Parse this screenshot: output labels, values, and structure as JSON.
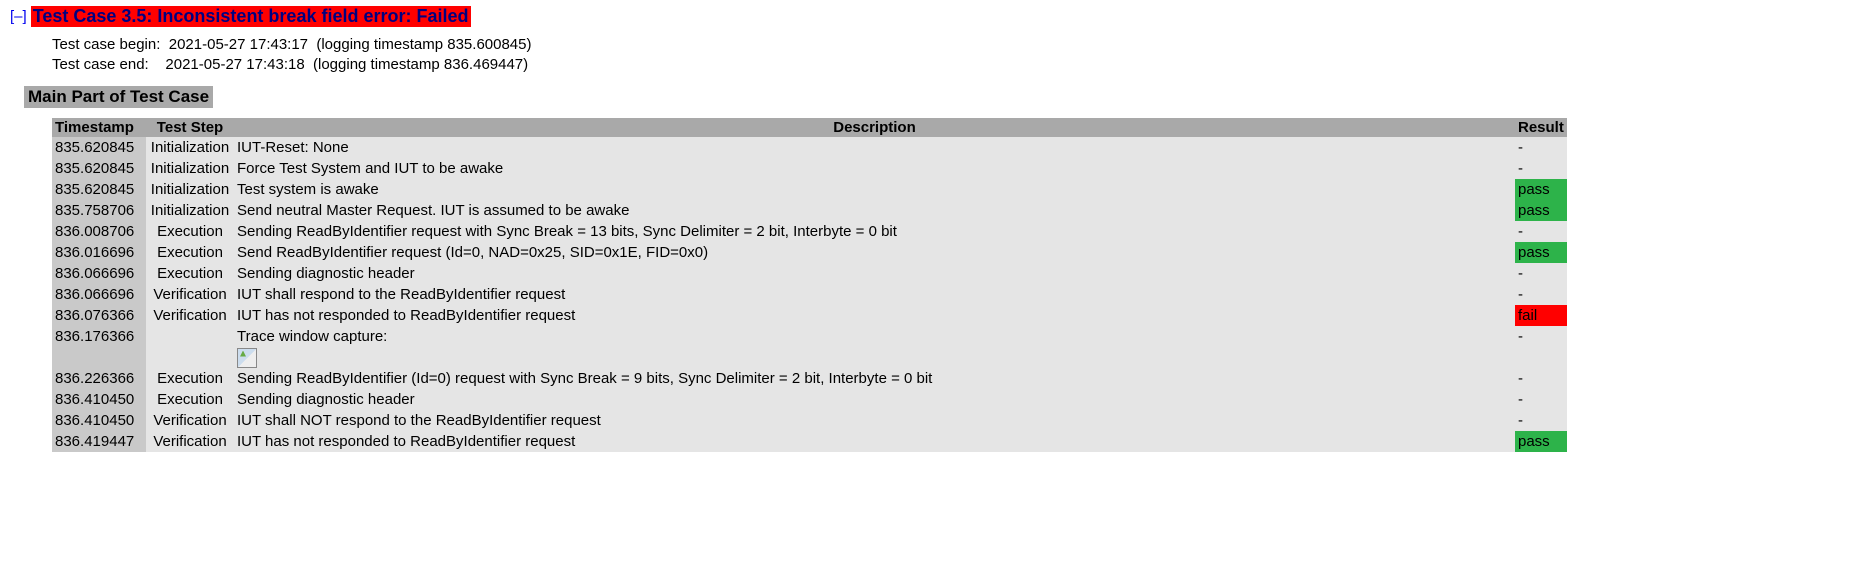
{
  "toggle": "[–]",
  "title": "Test Case 3.5: Inconsistent break field error: Failed",
  "meta_begin": "Test case begin:  2021-05-27 17:43:17  (logging timestamp 835.600845)",
  "meta_end": "Test case end:    2021-05-27 17:43:18  (logging timestamp 836.469447)",
  "section": "Main Part of Test Case",
  "headers": {
    "ts": "Timestamp",
    "step": "Test Step",
    "desc": "Description",
    "res": "Result"
  },
  "rows": [
    {
      "ts": "835.620845",
      "step": "Initialization",
      "desc": "IUT-Reset: None",
      "res": "-",
      "res_class": ""
    },
    {
      "ts": "835.620845",
      "step": "Initialization",
      "desc": "Force Test System and IUT to be awake",
      "res": "-",
      "res_class": ""
    },
    {
      "ts": "835.620845",
      "step": "Initialization",
      "desc": "Test system is awake",
      "res": "pass",
      "res_class": "res-pass"
    },
    {
      "ts": "835.758706",
      "step": "Initialization",
      "desc": "Send neutral Master Request. IUT is assumed to be awake",
      "res": "pass",
      "res_class": "res-pass"
    },
    {
      "ts": "836.008706",
      "step": "Execution",
      "desc": "Sending ReadByIdentifier request with Sync Break = 13 bits, Sync Delimiter = 2 bit, Interbyte = 0 bit",
      "res": "-",
      "res_class": ""
    },
    {
      "ts": "836.016696",
      "step": "Execution",
      "desc": "Send ReadByIdentifier request (Id=0, NAD=0x25, SID=0x1E, FID=0x0)",
      "res": "pass",
      "res_class": "res-pass"
    },
    {
      "ts": "836.066696",
      "step": "Execution",
      "desc": "Sending diagnostic header",
      "res": "-",
      "res_class": ""
    },
    {
      "ts": "836.066696",
      "step": "Verification",
      "desc": "IUT shall respond to the ReadByIdentifier request",
      "res": "-",
      "res_class": ""
    },
    {
      "ts": "836.076366",
      "step": "Verification",
      "desc": "IUT has not responded to ReadByIdentifier request",
      "res": "fail",
      "res_class": "res-fail"
    },
    {
      "ts": "836.176366",
      "step": "",
      "desc": "Trace window capture:",
      "res": "-",
      "res_class": "",
      "trace_img": true
    },
    {
      "ts": "836.226366",
      "step": "Execution",
      "desc": "Sending ReadByIdentifier (Id=0) request with Sync Break = 9 bits, Sync Delimiter = 2 bit, Interbyte = 0 bit",
      "res": "-",
      "res_class": ""
    },
    {
      "ts": "836.410450",
      "step": "Execution",
      "desc": "Sending diagnostic header",
      "res": "-",
      "res_class": ""
    },
    {
      "ts": "836.410450",
      "step": "Verification",
      "desc": "IUT shall NOT respond to the ReadByIdentifier request",
      "res": "-",
      "res_class": ""
    },
    {
      "ts": "836.419447",
      "step": "Verification",
      "desc": "IUT has not responded to ReadByIdentifier request",
      "res": "pass",
      "res_class": "res-pass"
    }
  ]
}
